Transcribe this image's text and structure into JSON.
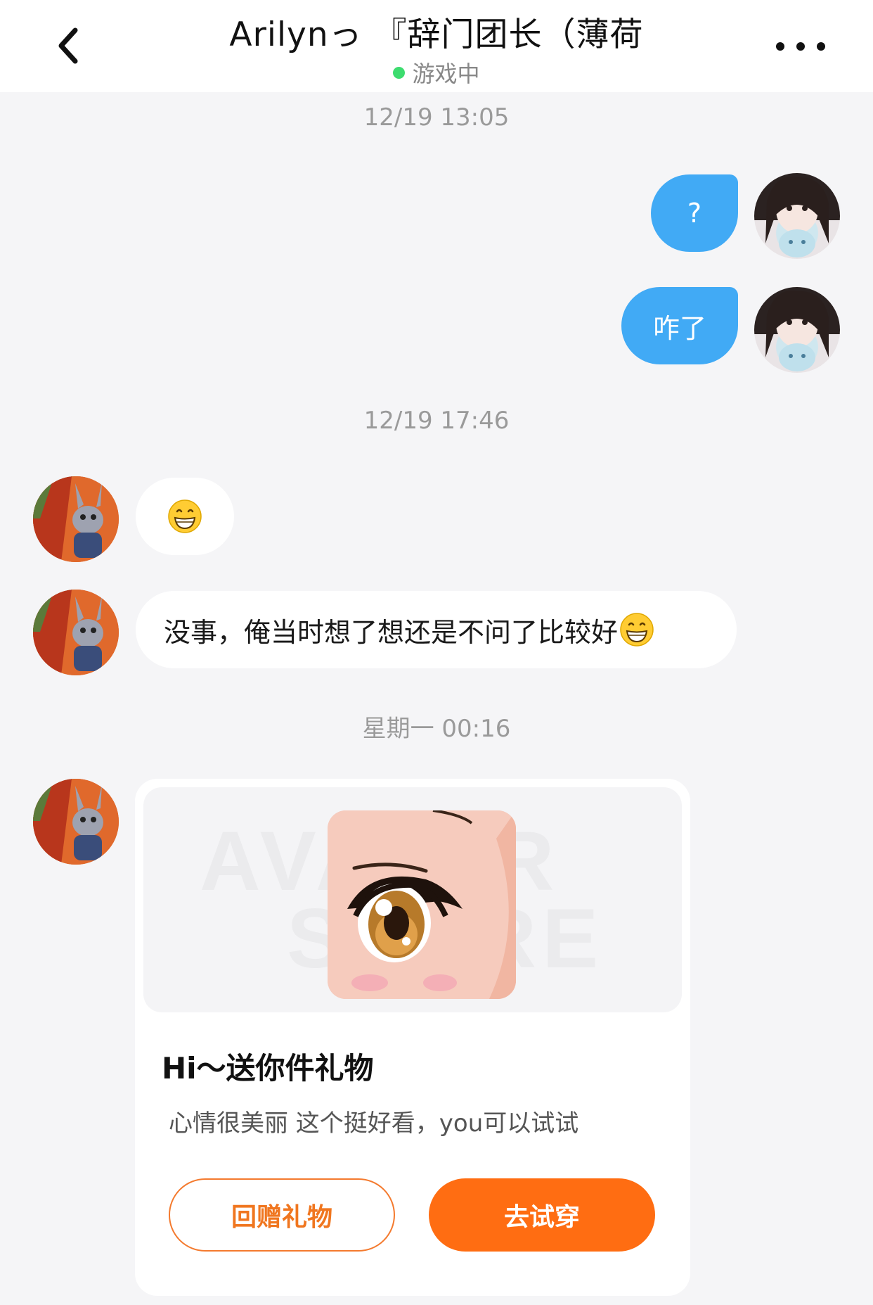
{
  "header": {
    "title": "Arilynっ 『辞门团长（薄荷",
    "status": "游戏中",
    "status_color": "#3ddc6f"
  },
  "timestamps": [
    "12/19 13:05",
    "12/19 17:46",
    "星期一 00:16"
  ],
  "messages": {
    "out_1": "?",
    "out_2": "咋了",
    "in_2": "没事，俺当时想了想还是不问了比较好"
  },
  "gift_card": {
    "title": "Hi～送你件礼物",
    "description": "心情很美丽 这个挺好看，you可以试试",
    "return_gift_label": "回赠礼物",
    "try_on_label": "去试穿"
  },
  "icons": {
    "back": "chevron-left-icon",
    "more": "more-dots-icon",
    "emoji": "grinning-face-emoji"
  },
  "colors": {
    "outgoing_bubble": "#41aaf5",
    "accent_orange": "#ff6d12"
  }
}
